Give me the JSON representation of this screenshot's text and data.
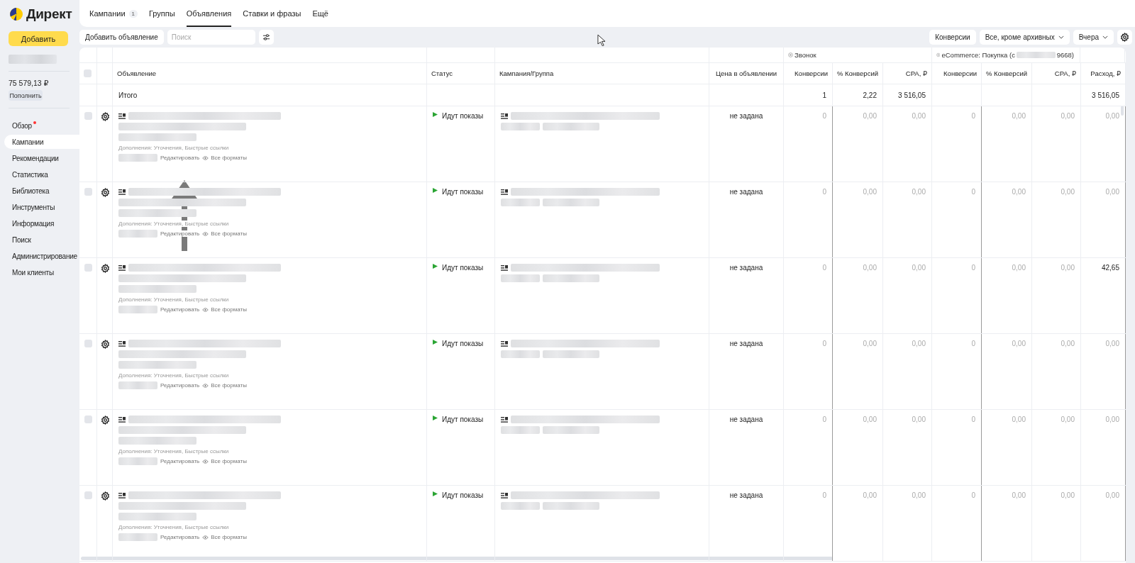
{
  "logo": {
    "text": "Директ"
  },
  "sidebar": {
    "add_button": "Добавить",
    "balance": "75 579,13 ₽",
    "top_up_button": "Пополнить",
    "items": [
      {
        "label": "Обзор",
        "dot": true,
        "selected": false
      },
      {
        "label": "Кампании",
        "dot": false,
        "selected": true
      },
      {
        "label": "Рекомендации",
        "dot": false,
        "selected": false
      },
      {
        "label": "Статистика",
        "dot": false,
        "selected": false
      },
      {
        "label": "Библиотека",
        "dot": false,
        "selected": false
      },
      {
        "label": "Инструменты",
        "dot": false,
        "selected": false
      },
      {
        "label": "Информация",
        "dot": false,
        "selected": false
      },
      {
        "label": "Поиск",
        "dot": false,
        "selected": false
      },
      {
        "label": "Администрирование",
        "dot": false,
        "selected": false
      },
      {
        "label": "Мои клиенты",
        "dot": false,
        "selected": false
      }
    ]
  },
  "tabs": [
    {
      "label": "Кампании",
      "badge": "1",
      "selected": false
    },
    {
      "label": "Группы",
      "selected": false
    },
    {
      "label": "Объявления",
      "selected": true
    },
    {
      "label": "Ставки и фразы",
      "selected": false
    },
    {
      "label": "Ещё",
      "selected": false
    }
  ],
  "toolbar": {
    "add_ad_button": "Добавить объявление",
    "search": {
      "placeholder": "Поиск"
    },
    "right_buttons": [
      {
        "label": "Конверсии",
        "dropdown": false
      },
      {
        "label": "Все, кроме архивных",
        "dropdown": true
      },
      {
        "label": "Вчера",
        "dropdown": true
      }
    ]
  },
  "table": {
    "header_checked": false,
    "groups": [
      {
        "label_parts": [
          "Звонок"
        ]
      },
      {
        "label_parts": [
          "eCommerce: Покупка (с",
          "9668)"
        ]
      }
    ],
    "columns": [
      "Объявление",
      "Статус",
      "Кампания/Группа",
      "Цена в объявлении",
      "Конверсии",
      "% Конверсий",
      "CPA, ₽",
      "Конверсии",
      "% Конверсий",
      "CPA, ₽",
      "Расход, ₽"
    ],
    "total": {
      "label": "Итого",
      "call": [
        "1",
        "2,22",
        "3 516,05"
      ],
      "expense": "3 516,05"
    },
    "rows": [
      {
        "checked": false,
        "extensions": "Дополнения: Уточнения, Быстрые ссылки",
        "edit_link": "Редактировать",
        "formats_link": "Все форматы",
        "status": "Идут показы",
        "price": "не задана",
        "values": [
          "0",
          "0,00",
          "0,00",
          "0",
          "0,00",
          "0,00",
          "0,00"
        ]
      },
      {
        "checked": false,
        "extensions": "Дополнения: Уточнения, Быстрые ссылки",
        "edit_link": "Редактировать",
        "formats_link": "Все форматы",
        "status": "Идут показы",
        "price": "не задана",
        "values": [
          "0",
          "0,00",
          "0,00",
          "0",
          "0,00",
          "0,00",
          "0,00"
        ]
      },
      {
        "checked": false,
        "extensions": "Дополнения: Уточнения, Быстрые ссылки",
        "edit_link": "Редактировать",
        "formats_link": "Все форматы",
        "status": "Идут показы",
        "price": "не задана",
        "values": [
          "0",
          "0,00",
          "0,00",
          "0",
          "0,00",
          "0,00",
          "42,65"
        ]
      },
      {
        "checked": false,
        "extensions": "Дополнения: Уточнения, Быстрые ссылки",
        "edit_link": "Редактировать",
        "formats_link": "Все форматы",
        "status": "Идут показы",
        "price": "не задана",
        "values": [
          "0",
          "0,00",
          "0,00",
          "0",
          "0,00",
          "0,00",
          "0,00"
        ]
      },
      {
        "checked": false,
        "extensions": "Дополнения: Уточнения, Быстрые ссылки",
        "edit_link": "Редактировать",
        "formats_link": "Все форматы",
        "status": "Идут показы",
        "price": "не задана",
        "values": [
          "0",
          "0,00",
          "0,00",
          "0",
          "0,00",
          "0,00",
          "0,00"
        ]
      },
      {
        "checked": false,
        "extensions": "Дополнения: Уточнения, Быстрые ссылки",
        "edit_link": "Редактировать",
        "formats_link": "Все форматы",
        "status": "Идут показы",
        "price": "не задана",
        "values": [
          "0",
          "0,00",
          "0,00",
          "0",
          "0,00",
          "0,00",
          "0,00"
        ]
      }
    ]
  }
}
